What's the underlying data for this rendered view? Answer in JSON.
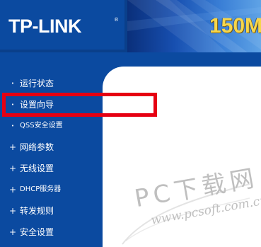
{
  "header": {
    "logo_text": "TP-LINK",
    "logo_reg": "®",
    "banner_speed": "150M"
  },
  "sidebar": {
    "items": [
      {
        "label": "运行状态",
        "bullet": "•"
      },
      {
        "label": "设置向导",
        "bullet": "•"
      },
      {
        "label": "QSS安全设置",
        "bullet": "•"
      },
      {
        "label": "网络参数",
        "bullet": "+"
      },
      {
        "label": "无线设置",
        "bullet": "+"
      },
      {
        "label": "DHCP服务器",
        "bullet": "+"
      },
      {
        "label": "转发规则",
        "bullet": "+"
      },
      {
        "label": "安全设置",
        "bullet": "+"
      }
    ]
  },
  "highlight": {
    "target": "设置向导",
    "color": "#e60012"
  },
  "watermark": {
    "main": "PC下载网",
    "url": "www.pcsoft.com.cn"
  },
  "colors": {
    "brand_blue": "#0b4aa0",
    "banner_gold": "#f6d64a",
    "highlight_red": "#e60012",
    "watermark_gray": "#bfbfbf"
  }
}
